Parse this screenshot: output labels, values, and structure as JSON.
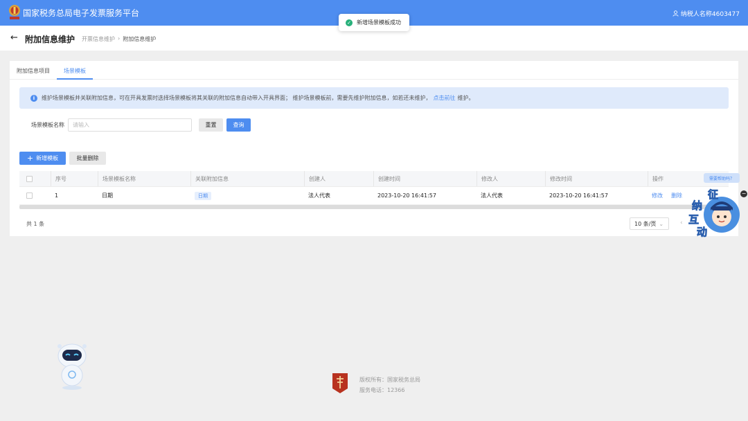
{
  "topbar": {
    "app_title": "国家税务总局电子发票服务平台",
    "user_label": "纳税人名称4603477",
    "user_icon": "user-icon"
  },
  "toast": {
    "message": "新增场景模板成功",
    "icon": "check-circle-icon"
  },
  "page_header": {
    "title": "附加信息维护",
    "breadcrumb": [
      "开票信息维护",
      "附加信息维护"
    ]
  },
  "tabs": [
    {
      "label": "附加信息项目",
      "active": false
    },
    {
      "label": "场景模板",
      "active": true
    }
  ],
  "notice": {
    "text_before": "维护场景模板并关联附加信息，可在开具发票时选择场景模板将其关联的附加信息自动带入开具界面； 维护场景模板前，需要先维护附加信息，如若还未维护，",
    "link_text": "点击前往",
    "text_after": "维护。"
  },
  "search": {
    "label": "场景模板名称",
    "placeholder": "请输入",
    "reset_label": "重置",
    "query_label": "查询"
  },
  "actions": {
    "add_label": "新增模板",
    "batch_delete_label": "批量删除"
  },
  "table": {
    "columns": [
      "序号",
      "场景模板名称",
      "关联附加信息",
      "创建人",
      "创建时间",
      "修改人",
      "修改时间",
      "操作"
    ],
    "rows": [
      {
        "index": "1",
        "name": "日期",
        "related": "日期",
        "creator": "法人代表",
        "created_at": "2023-10-20 16:41:57",
        "modifier": "法人代表",
        "modified_at": "2023-10-20 16:41:57",
        "edit_label": "修改",
        "delete_label": "删除"
      }
    ]
  },
  "pagination": {
    "total_text": "共 1 条",
    "page_size": "10 条/页"
  },
  "help_widget": {
    "tip": "需要帮助吗？",
    "chars": [
      "征",
      "纳",
      "互",
      "动"
    ]
  },
  "footer": {
    "copyright": "版权所有：国家税务总局",
    "phone": "服务电话：12366"
  },
  "colors": {
    "primary": "#4e8df0",
    "success": "#27b07a",
    "notice_bg": "#dfeafb"
  }
}
